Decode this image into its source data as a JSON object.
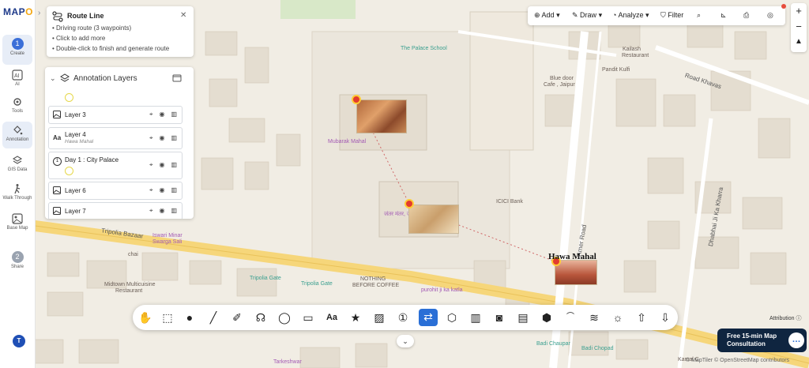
{
  "app": {
    "logo_text_a": "MAP",
    "logo_text_b": "O"
  },
  "rail": {
    "items": [
      {
        "label": "Create",
        "num": "1"
      },
      {
        "label": "AI"
      },
      {
        "label": "Tools"
      },
      {
        "label": "Annotation"
      },
      {
        "label": "GIS Data"
      },
      {
        "label": "Walk Through"
      },
      {
        "label": "Base Map"
      },
      {
        "label": "Share",
        "num": "2"
      }
    ],
    "user_initial": "T"
  },
  "route_panel": {
    "title": "Route Line",
    "lines": [
      "• Driving route (3 waypoints)",
      "• Click to add more",
      "• Double-click to finish and generate route"
    ]
  },
  "layers": {
    "title": "Annotation Layers",
    "rows": [
      {
        "name": "Layer 3"
      },
      {
        "name": "Layer 4",
        "sub": "Hawa Mahal"
      },
      {
        "name": "Day 1 : City Palace"
      },
      {
        "name": "Layer 6"
      },
      {
        "name": "Layer 7"
      }
    ]
  },
  "topbar": {
    "add": "Add",
    "draw": "Draw",
    "analyze": "Analyze",
    "filter": "Filter"
  },
  "map_labels": {
    "palace_school": "The Palace School",
    "kailash": "Kailash",
    "kailash2": "Restaurant",
    "pandit": "Pandit Kulfi",
    "bluedoor1": "Blue door",
    "bluedoor2": "Cafe , Jaipur",
    "road_khavas": "Road Khavas",
    "mubarak": "Mubarak Mahal",
    "icici": "ICICI Bank",
    "tripolia": "Tripolia Bazaar",
    "iswari1": "Iswari Minar",
    "iswari2": "Swarga Sali",
    "chai": "chai",
    "tripolia_gate": "Tripolia Gate",
    "tripolia_gate2": "Tripolia Gate",
    "nothing1": "NOTHING",
    "nothing2": "BEFORE COFFEE",
    "purohit": "purohit ji ka katla",
    "midtown1": "Midtown Multicuisine",
    "midtown2": "Restaurant",
    "amer": "Amer Road",
    "dhabhai": "Dhabhai Ji Ka Kharra",
    "badi_chaupar": "Badi Chaupar",
    "badi_chopad": "Badi Chopad",
    "tarkeshwar": "Tarkeshwar",
    "jantar": "जंतर मंतर, ज",
    "kamal": "Kamal C"
  },
  "hawa_label": "Hawa Mahal",
  "consult": {
    "text": "Free 15-min Map Consultation"
  },
  "attribution": "Attribution",
  "copyright": "© MapTiler © OpenStreetMap contributors"
}
